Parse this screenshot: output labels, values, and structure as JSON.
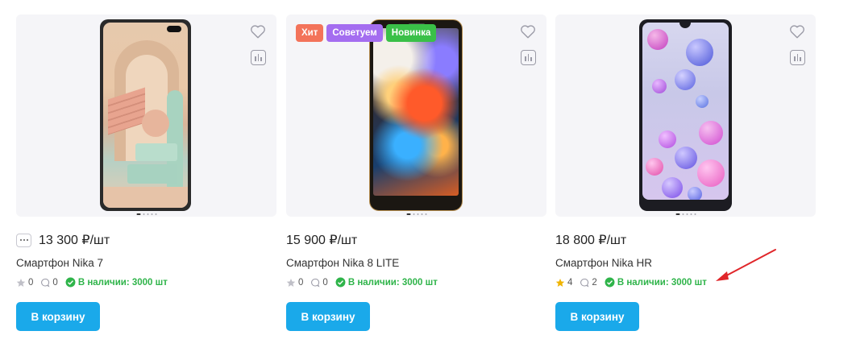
{
  "products": [
    {
      "name": "Смартфон Nika 7",
      "price": "13 300 ₽/шт",
      "rating": "0",
      "reviews": "0",
      "stock": "В наличии: 3000 шт",
      "cart_label": "В корзину",
      "badges": []
    },
    {
      "name": "Смартфон Nika 8 LITE",
      "price": "15 900 ₽/шт",
      "rating": "0",
      "reviews": "0",
      "stock": "В наличии: 3000 шт",
      "cart_label": "В корзину",
      "badges": [
        {
          "label": "Хит",
          "color": "#f3735a"
        },
        {
          "label": "Советуем",
          "color": "#a46df0"
        },
        {
          "label": "Новинка",
          "color": "#3ac048"
        }
      ]
    },
    {
      "name": "Смартфон Nika HR",
      "price": "18 800 ₽/шт",
      "rating": "4",
      "reviews": "2",
      "stock": "В наличии: 3000 шт",
      "cart_label": "В корзину",
      "badges": []
    }
  ],
  "colors": {
    "accent": "#1aa9ea",
    "stock_green": "#2fb44a",
    "star_filled": "#f0b400",
    "star_empty": "#c0c0c8",
    "annotation_arrow": "#e0262a"
  },
  "icons": [
    "heart-icon",
    "compare-icon",
    "star-icon",
    "comment-icon",
    "check-circle-icon",
    "more-icon"
  ]
}
